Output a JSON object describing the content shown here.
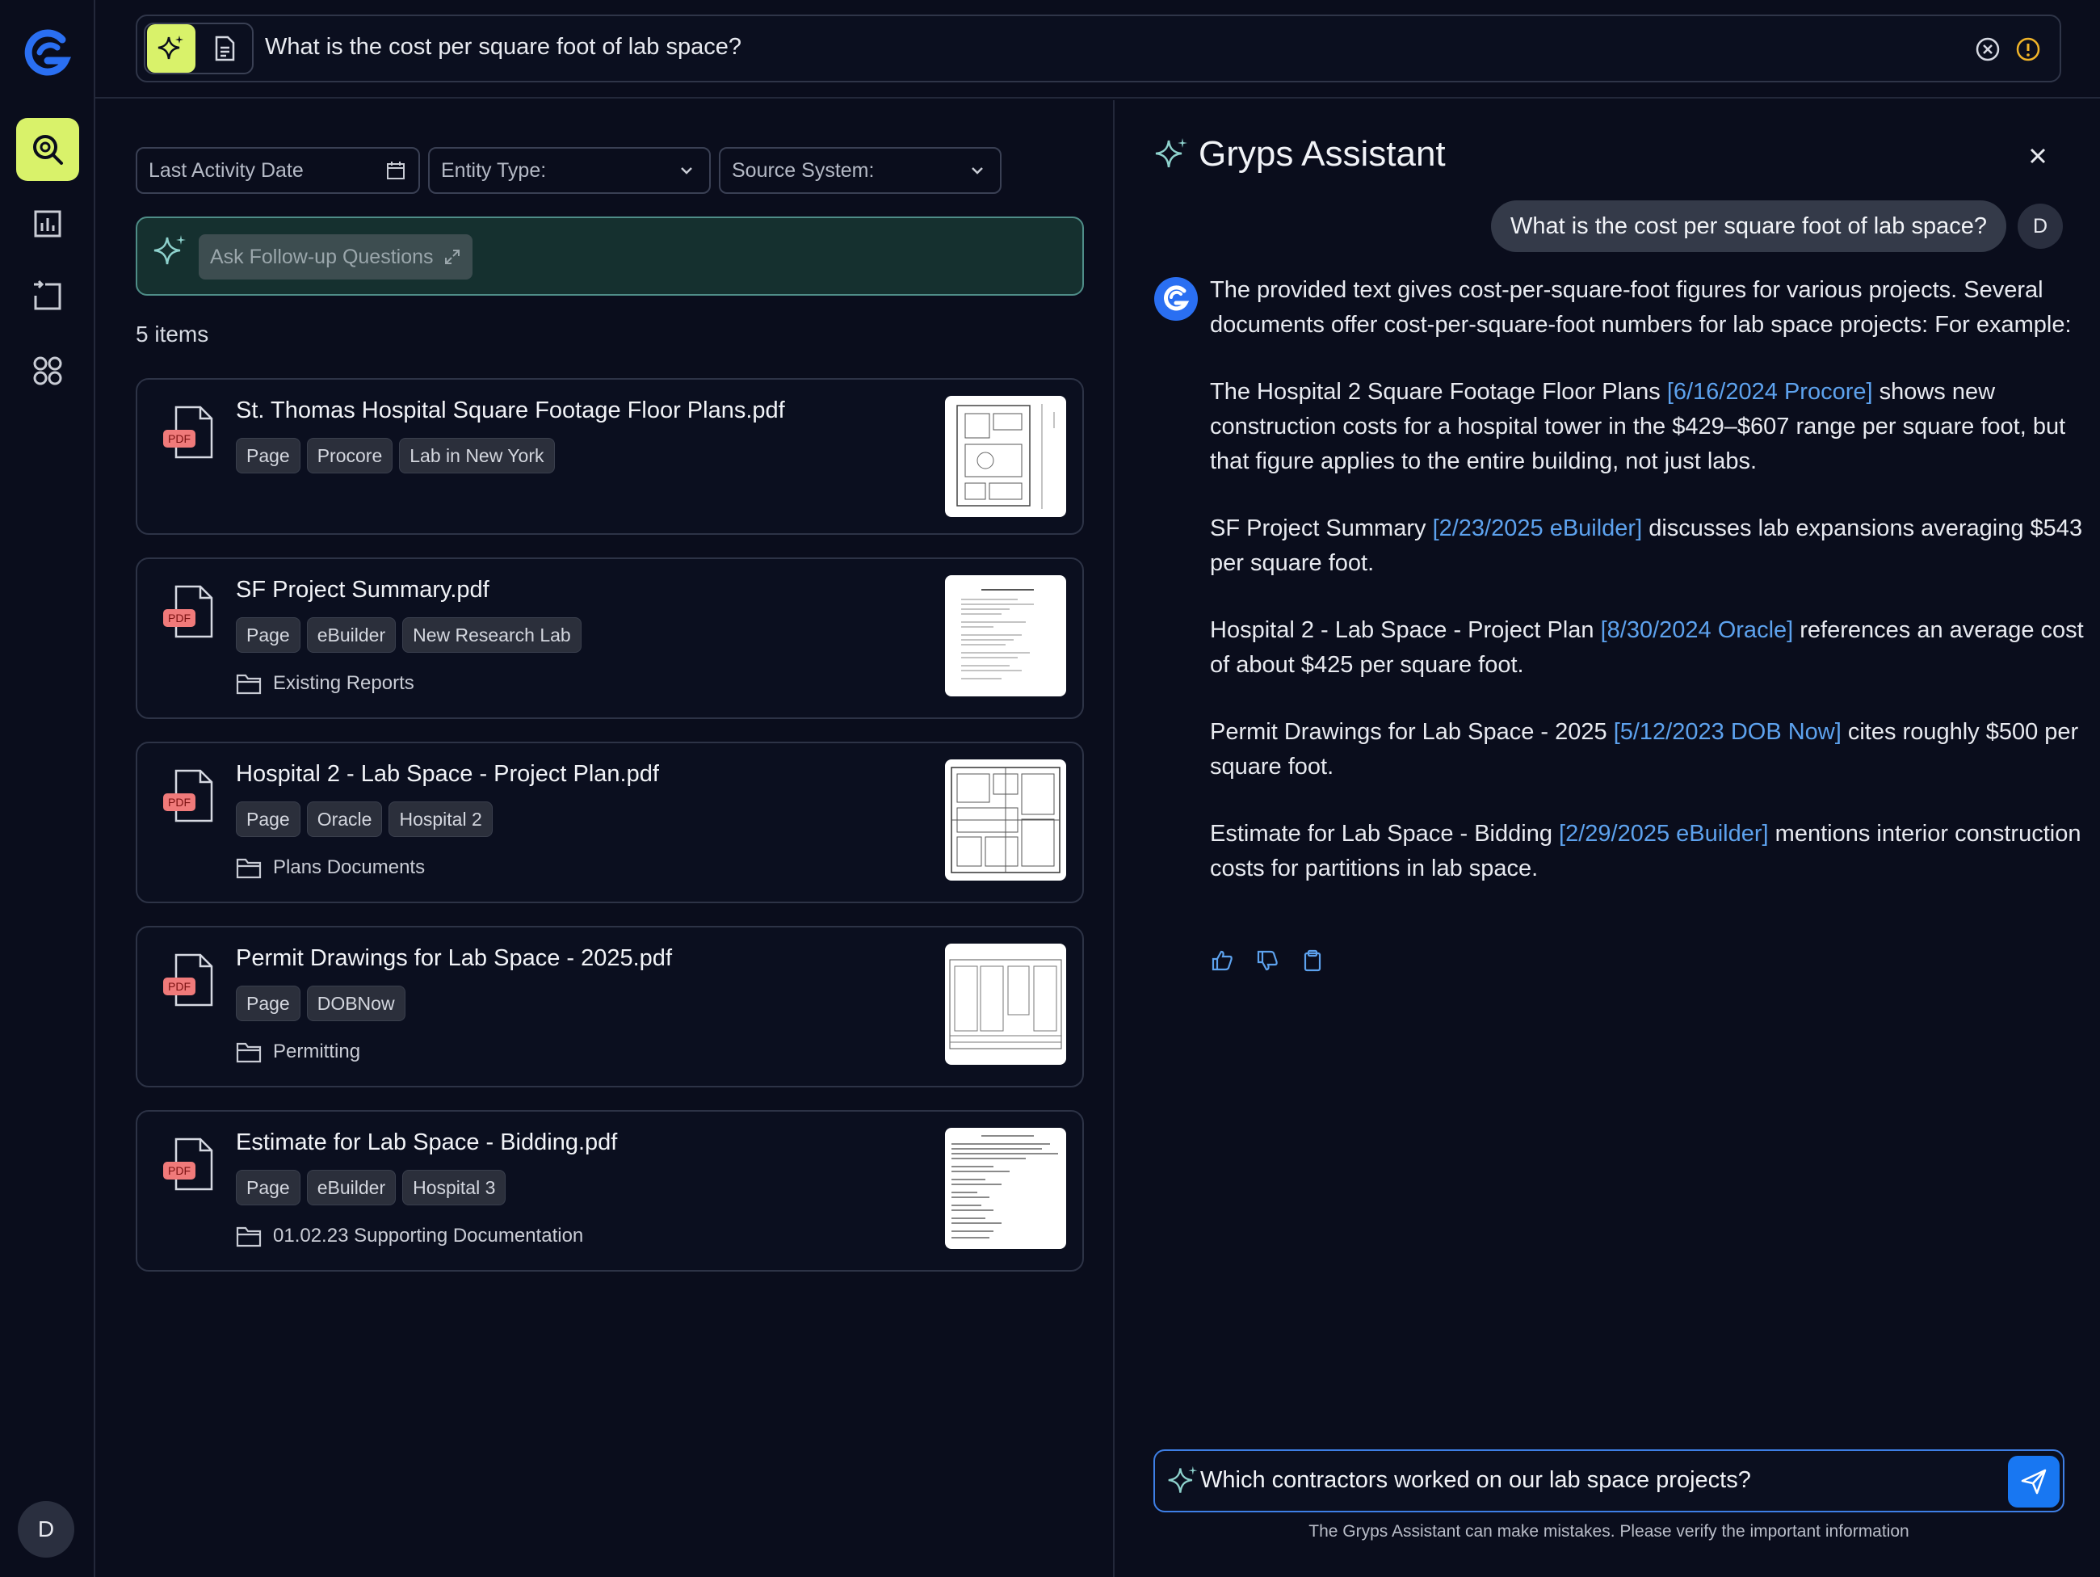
{
  "search": {
    "query": "What is the cost per square foot of lab space?"
  },
  "filters": {
    "last_activity_date": "Last Activity Date",
    "entity_type": "Entity Type:",
    "source_system": "Source System:"
  },
  "followup": {
    "button_label": "Ask Follow-up Questions"
  },
  "results": {
    "count_label": "5 items",
    "items": [
      {
        "title": "St. Thomas Hospital Square Footage Floor Plans.pdf",
        "tags": [
          "Page",
          "Procore",
          "Lab in New York"
        ],
        "folder": ""
      },
      {
        "title": "SF Project Summary.pdf",
        "tags": [
          "Page",
          "eBuilder",
          "New Research Lab"
        ],
        "folder": "Existing Reports"
      },
      {
        "title": "Hospital 2 - Lab Space - Project Plan.pdf",
        "tags": [
          "Page",
          "Oracle",
          "Hospital 2"
        ],
        "folder": "Plans Documents"
      },
      {
        "title": "Permit Drawings for Lab Space - 2025.pdf",
        "tags": [
          "Page",
          "DOBNow"
        ],
        "folder": "Permitting"
      },
      {
        "title": "Estimate for Lab Space - Bidding.pdf",
        "tags": [
          "Page",
          "eBuilder",
          "Hospital 3"
        ],
        "folder": "01.02.23 Supporting Documentation"
      }
    ],
    "pdf_badge": "PDF"
  },
  "assistant": {
    "title": "Gryps Assistant",
    "user_message": "What is the cost per square foot of lab space?",
    "user_initial": "D",
    "answer": {
      "intro": "The provided text gives cost-per-square-foot figures for various projects. Several documents offer cost-per-square-foot numbers for lab space projects: For example:",
      "p1_pre": "The Hospital 2 Square Footage Floor Plans ",
      "p1_cite": "[6/16/2024 Procore]",
      "p1_post": " shows new construction costs for a hospital tower in the $429–$607 range per square foot, but that figure applies to the entire building, not just labs.",
      "p2_pre": "SF Project Summary ",
      "p2_cite": "[2/23/2025 eBuilder]",
      "p2_post": " discusses lab expansions averaging $543 per square foot.",
      "p3_pre": "Hospital 2 - Lab Space - Project Plan ",
      "p3_cite": "[8/30/2024 Oracle]",
      "p3_post": " references an average cost of about $425 per square foot.",
      "p4_pre": "Permit Drawings for Lab Space - 2025 ",
      "p4_cite": "[5/12/2023 DOB Now]",
      "p4_post": " cites roughly $500 per square foot.",
      "p5_pre": "Estimate for Lab Space - Bidding ",
      "p5_cite": "[2/29/2025 eBuilder]",
      "p5_post": " mentions interior construction costs for partitions in lab space."
    },
    "input_value": "Which contractors worked on our lab space projects?",
    "disclaimer": "The Gryps Assistant can make mistakes. Please verify the important information"
  },
  "sidebar": {
    "user_initial": "D"
  },
  "colors": {
    "accent": "#d9f26a",
    "link": "#5da2ee",
    "send": "#1877f2",
    "followup_bg": "#15302f"
  }
}
